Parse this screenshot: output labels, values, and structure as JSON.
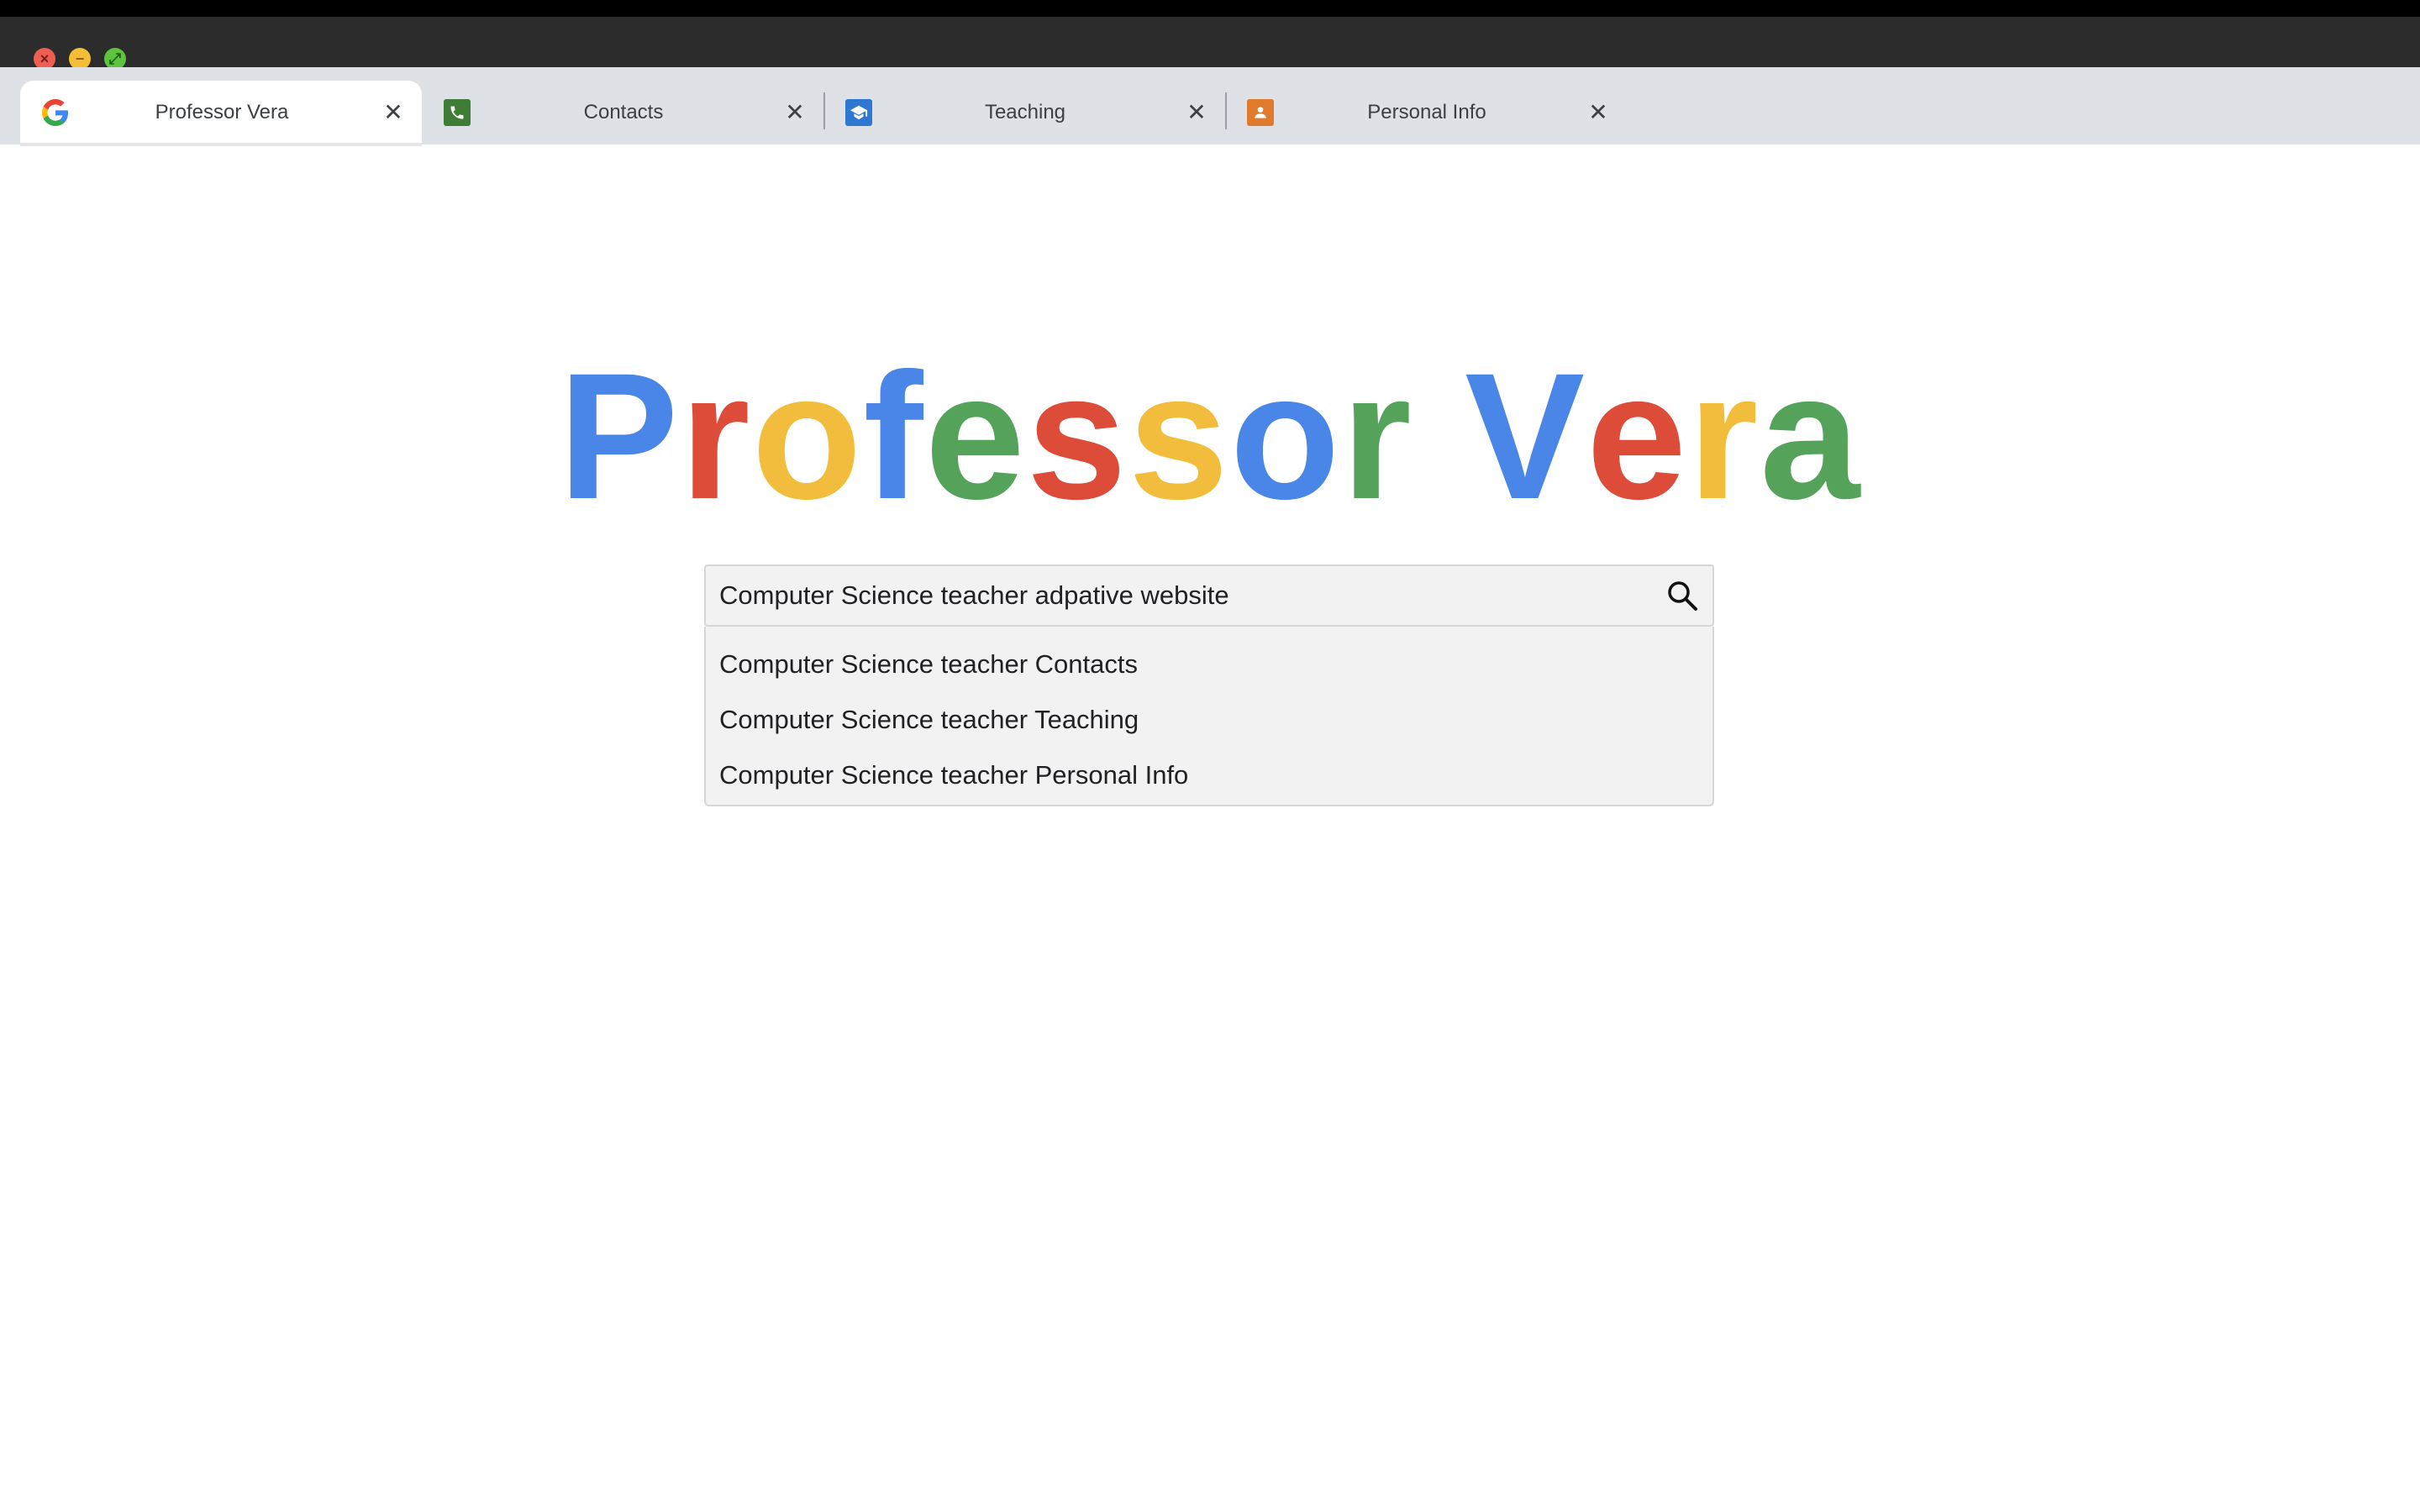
{
  "window": {
    "controls": [
      {
        "name": "close",
        "icon": "close-icon",
        "color": "#ec5f52"
      },
      {
        "name": "minimize",
        "icon": "minimize-icon",
        "color": "#f4bf36"
      },
      {
        "name": "zoom",
        "icon": "fullscreen-icon",
        "color": "#5dc43f"
      }
    ]
  },
  "tabs": [
    {
      "label": "Professor Vera",
      "icon": "google-g-icon",
      "active": true
    },
    {
      "label": "Contacts",
      "icon": "phone-icon",
      "icon_color": "#3f7d37",
      "active": false
    },
    {
      "label": "Teaching",
      "icon": "graduation-cap-icon",
      "icon_color": "#2f78d1",
      "active": false
    },
    {
      "label": "Personal Info",
      "icon": "person-icon",
      "icon_color": "#e07a2c",
      "active": false
    }
  ],
  "logo": {
    "letters": [
      {
        "ch": "P",
        "color": "#4a86e8"
      },
      {
        "ch": "r",
        "color": "#dd4b39"
      },
      {
        "ch": "o",
        "color": "#f2bd3c"
      },
      {
        "ch": "f",
        "color": "#4a86e8"
      },
      {
        "ch": "e",
        "color": "#55a35a"
      },
      {
        "ch": "s",
        "color": "#dd4b39"
      },
      {
        "ch": "s",
        "color": "#f2bd3c"
      },
      {
        "ch": "o",
        "color": "#4a86e8"
      },
      {
        "ch": "r",
        "color": "#55a35a"
      },
      {
        "ch": " ",
        "color": "#ffffff"
      },
      {
        "ch": "V",
        "color": "#4a86e8"
      },
      {
        "ch": "e",
        "color": "#dd4b39"
      },
      {
        "ch": "r",
        "color": "#f2bd3c"
      },
      {
        "ch": "a",
        "color": "#55a35a"
      }
    ]
  },
  "search": {
    "value": "Computer Science teacher adpative website",
    "icon": "search-icon"
  },
  "suggestions": [
    "Computer Science teacher Contacts",
    "Computer Science teacher Teaching",
    "Computer Science teacher Personal Info"
  ]
}
